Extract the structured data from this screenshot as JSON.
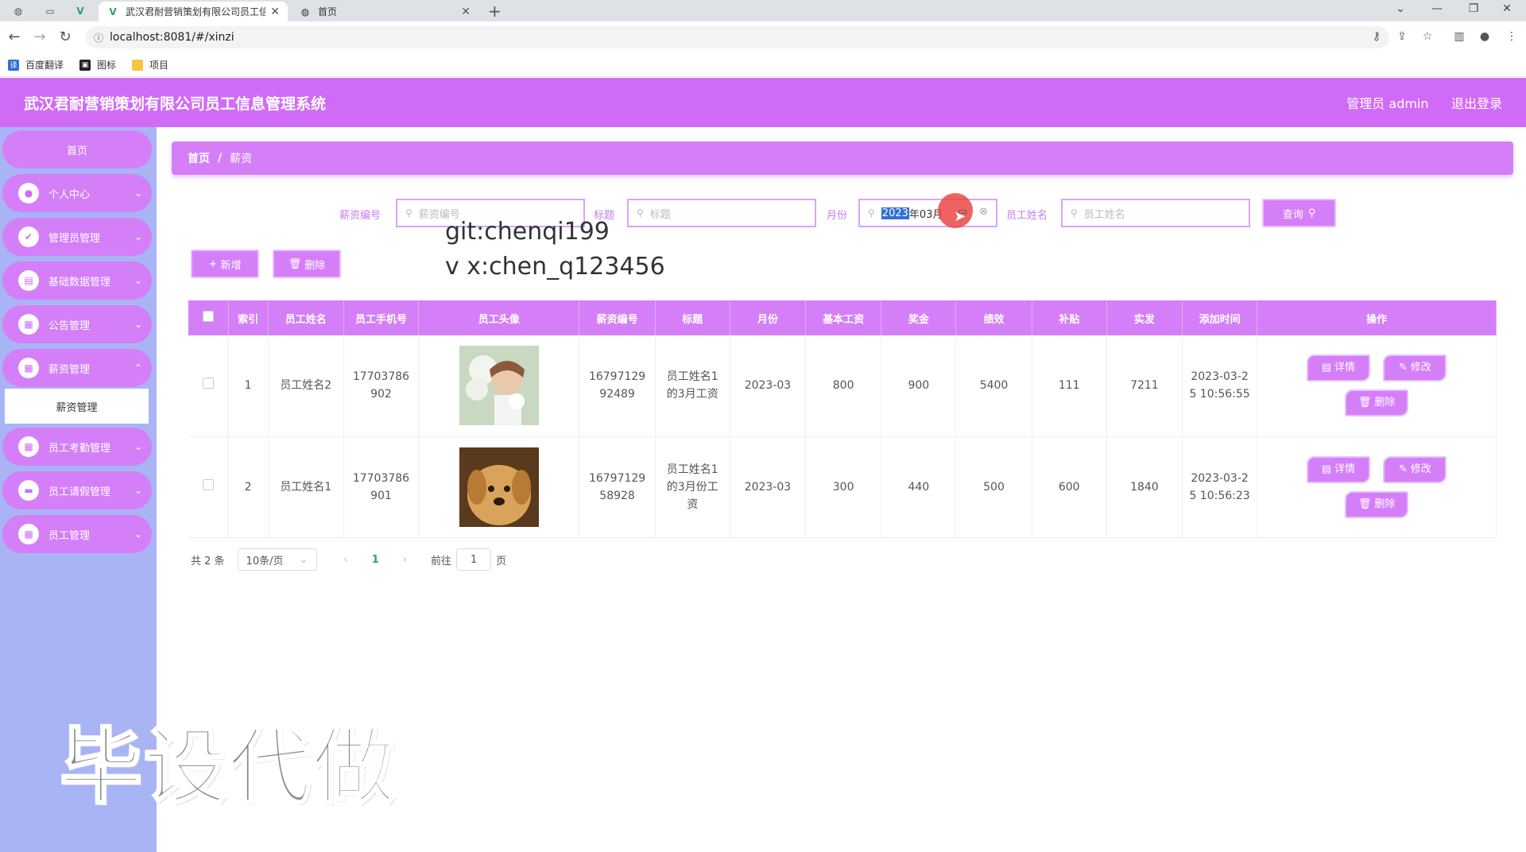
{
  "browser": {
    "tabs": [
      {
        "title": "武汉君耐营销策划有限公司员工信",
        "active": true
      },
      {
        "title": "首页",
        "active": false
      }
    ],
    "url": "localhost:8081/#/xinzi",
    "bookmarks": [
      "百度翻译",
      "图标",
      "项目"
    ]
  },
  "header": {
    "title": "武汉君耐营销策划有限公司员工信息管理系统",
    "user": "管理员 admin",
    "logout": "退出登录"
  },
  "sidebar": {
    "home": "首页",
    "items": [
      {
        "label": "个人中心",
        "icon": "user-icon"
      },
      {
        "label": "管理员管理",
        "icon": "check-icon"
      },
      {
        "label": "基础数据管理",
        "icon": "clipboard-icon"
      },
      {
        "label": "公告管理",
        "icon": "grid-icon"
      },
      {
        "label": "薪资管理",
        "icon": "grid-icon"
      },
      {
        "label": "员工考勤管理",
        "icon": "grid-icon"
      },
      {
        "label": "员工请假管理",
        "icon": "chat-icon"
      },
      {
        "label": "员工管理",
        "icon": "grid-icon"
      }
    ],
    "sub_active": "薪资管理"
  },
  "breadcrumb": {
    "home": "首页",
    "sep": "/",
    "current": "薪资"
  },
  "filters": {
    "salary_no": {
      "label": "薪资编号",
      "placeholder": "薪资编号"
    },
    "title": {
      "label": "标题",
      "placeholder": "标题"
    },
    "month": {
      "label": "月份",
      "value_selected": "2023",
      "value_rest": "年03月"
    },
    "employee": {
      "label": "员工姓名",
      "placeholder": "员工姓名"
    },
    "query_button": "查询"
  },
  "overlay": {
    "line1": "git:chenqi199",
    "line2": "v x:chen_q123456"
  },
  "actions": {
    "add": "新增",
    "delete": "删除"
  },
  "table": {
    "headers": [
      "索引",
      "员工姓名",
      "员工手机号",
      "员工头像",
      "薪资编号",
      "标题",
      "月份",
      "基本工资",
      "奖金",
      "绩效",
      "补贴",
      "实发",
      "添加时间",
      "操作"
    ],
    "rows": [
      {
        "index": "1",
        "name": "员工姓名2",
        "phone_a": "17703786",
        "phone_b": "902",
        "salary_no_a": "16797129",
        "salary_no_b": "92489",
        "title_a": "员工姓名1",
        "title_b": "的3月工资",
        "title_c": "",
        "month": "2023-03",
        "base": "800",
        "bonus": "900",
        "perf": "5400",
        "subsidy": "111",
        "net": "7211",
        "time_a": "2023-03-2",
        "time_b": "5 10:56:55"
      },
      {
        "index": "2",
        "name": "员工姓名1",
        "phone_a": "17703786",
        "phone_b": "901",
        "salary_no_a": "16797129",
        "salary_no_b": "58928",
        "title_a": "员工姓名1",
        "title_b": "的3月份工",
        "title_c": "资",
        "month": "2023-03",
        "base": "300",
        "bonus": "440",
        "perf": "500",
        "subsidy": "600",
        "net": "1840",
        "time_a": "2023-03-2",
        "time_b": "5 10:56:23"
      }
    ],
    "op_detail": "详情",
    "op_edit": "修改",
    "op_delete": "删除"
  },
  "pagination": {
    "total": "共 2 条",
    "size": "10条/页",
    "current": "1",
    "goto": "前往",
    "goto_value": "1",
    "page_unit": "页"
  },
  "watermark": "毕设代做",
  "colors": {
    "primary": "#d06bf7",
    "button": "#d47ff8",
    "sidebar_bg": "#a9b4f5"
  }
}
